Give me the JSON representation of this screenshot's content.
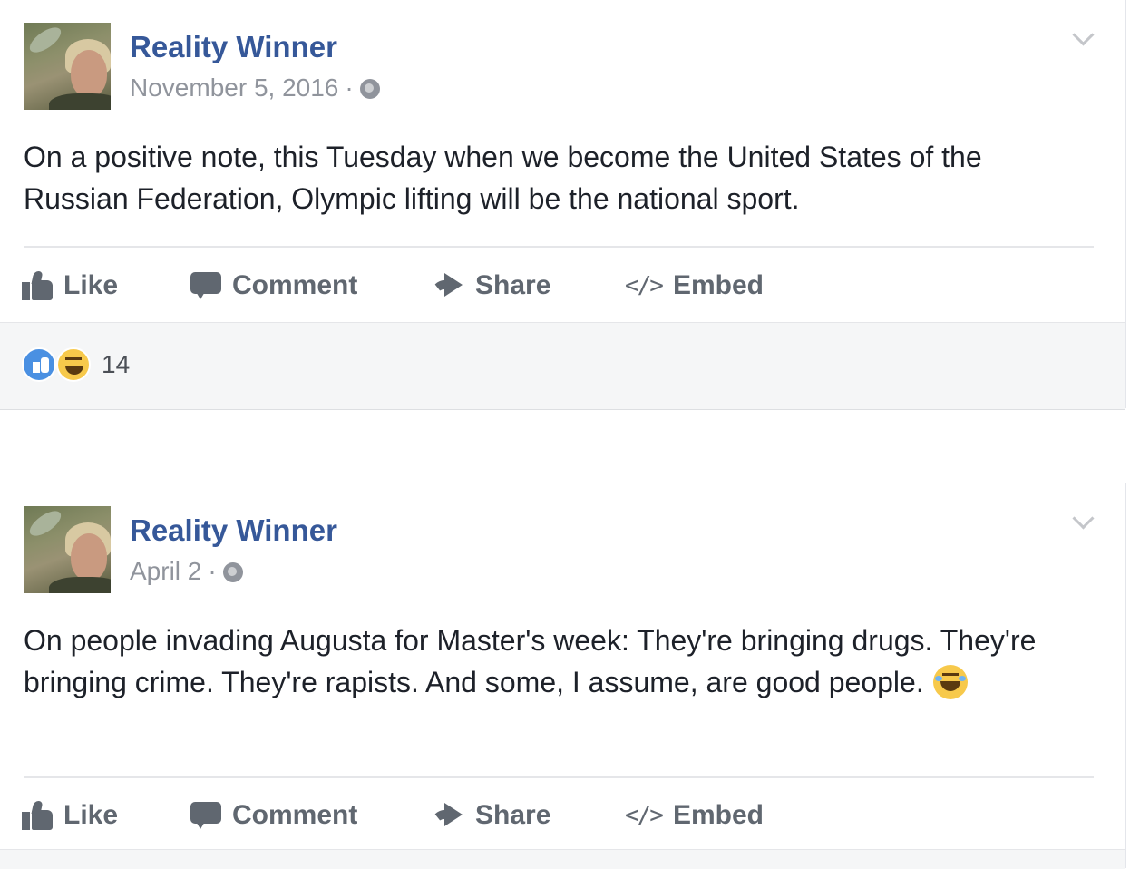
{
  "posts": [
    {
      "author": "Reality Winner",
      "date": "November 5, 2016",
      "separator": "·",
      "body": "On a positive note, this Tuesday when we become the United States of the Russian Federation, Olympic lifting will be the national sport.",
      "actions": {
        "like": "Like",
        "comment": "Comment",
        "share": "Share",
        "embed": "Embed"
      },
      "reactions": {
        "count": "14",
        "types": [
          "like",
          "haha"
        ]
      }
    },
    {
      "author": "Reality Winner",
      "date": "April 2",
      "separator": "·",
      "body": "On people invading Augusta for Master's week: They're bringing drugs. They're bringing crime. They're rapists. And some, I assume, are good people.",
      "body_emoji": "laughing-tears-emoji",
      "actions": {
        "like": "Like",
        "comment": "Comment",
        "share": "Share",
        "embed": "Embed"
      }
    }
  ],
  "icons": {
    "privacy": "globe-icon",
    "menu": "chevron-down-icon",
    "like": "thumbs-up-icon",
    "comment": "comment-icon",
    "share": "share-arrow-icon",
    "embed": "code-brackets-icon"
  },
  "colors": {
    "author": "#365899",
    "meta": "#90949c",
    "body": "#1d2129",
    "action": "#606770",
    "like_reaction": "#4a90e2",
    "haha_reaction": "#f7c94b"
  },
  "embed_glyph": "</>"
}
